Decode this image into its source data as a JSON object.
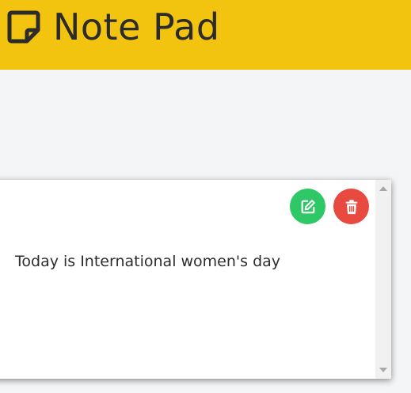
{
  "header": {
    "title": "Note Pad",
    "icon": "sticky-note-icon",
    "background": "#f2c40f"
  },
  "note": {
    "text": "Today is International women's day",
    "edit_icon": "edit-icon",
    "delete_icon": "trash-icon",
    "edit_color": "#2ec866",
    "delete_color": "#e84a3f"
  },
  "page": {
    "background": "#f3f5f7"
  }
}
